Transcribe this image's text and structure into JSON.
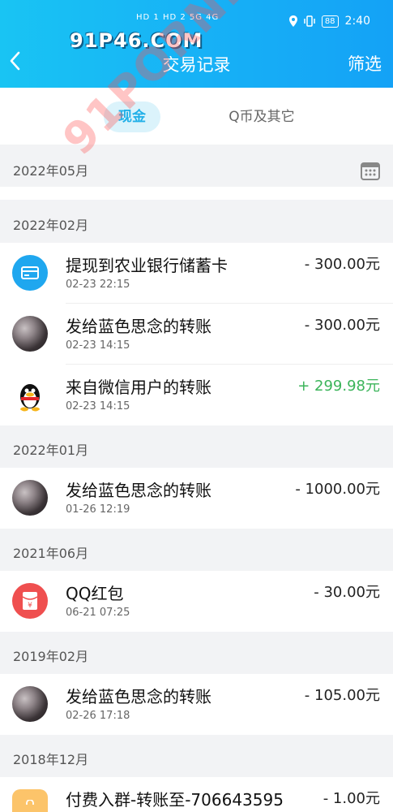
{
  "status": {
    "signal_left": "HD 1 HD 2 5G 4G",
    "battery": "88",
    "time": "2:40"
  },
  "watermark_top": "91P46.COM",
  "watermark_mid": "91PORN.COM",
  "nav": {
    "title": "交易记录",
    "filter": "筛选"
  },
  "tabs": {
    "cash": "现金",
    "qcoin": "Q币及其它"
  },
  "sections": [
    {
      "month": "2022年05月"
    },
    {
      "month": "2022年02月"
    },
    {
      "month": "2022年01月"
    },
    {
      "month": "2021年06月"
    },
    {
      "month": "2019年02月"
    },
    {
      "month": "2018年12月"
    }
  ],
  "items": [
    {
      "name": "提现到农业银行储蓄卡",
      "time": "02-23 22:15",
      "amount": "- 300.00元",
      "icon": "bank-card-icon"
    },
    {
      "name": "发给蓝色思念的转账",
      "time": "02-23 14:15",
      "amount": "- 300.00元",
      "icon": "user-avatar"
    },
    {
      "name": "来自微信用户的转账",
      "time": "02-23 14:15",
      "amount": "+ 299.98元",
      "icon": "qq-penguin-icon"
    },
    {
      "name": "发给蓝色思念的转账",
      "time": "01-26 12:19",
      "amount": "- 1000.00元",
      "icon": "user-avatar"
    },
    {
      "name": "QQ红包",
      "time": "06-21 07:25",
      "amount": "- 30.00元",
      "icon": "red-packet-icon"
    },
    {
      "name": "发给蓝色思念的转账",
      "time": "02-26 17:18",
      "amount": "- 105.00元",
      "icon": "user-avatar"
    },
    {
      "name": "付费入群-转账至-706643595",
      "time": "",
      "amount": "- 1.00元",
      "icon": "shopping-bag-icon"
    }
  ],
  "colors": {
    "accent": "#19b4f5",
    "positive": "#3bb45a",
    "red_packet": "#ef4f4f"
  }
}
